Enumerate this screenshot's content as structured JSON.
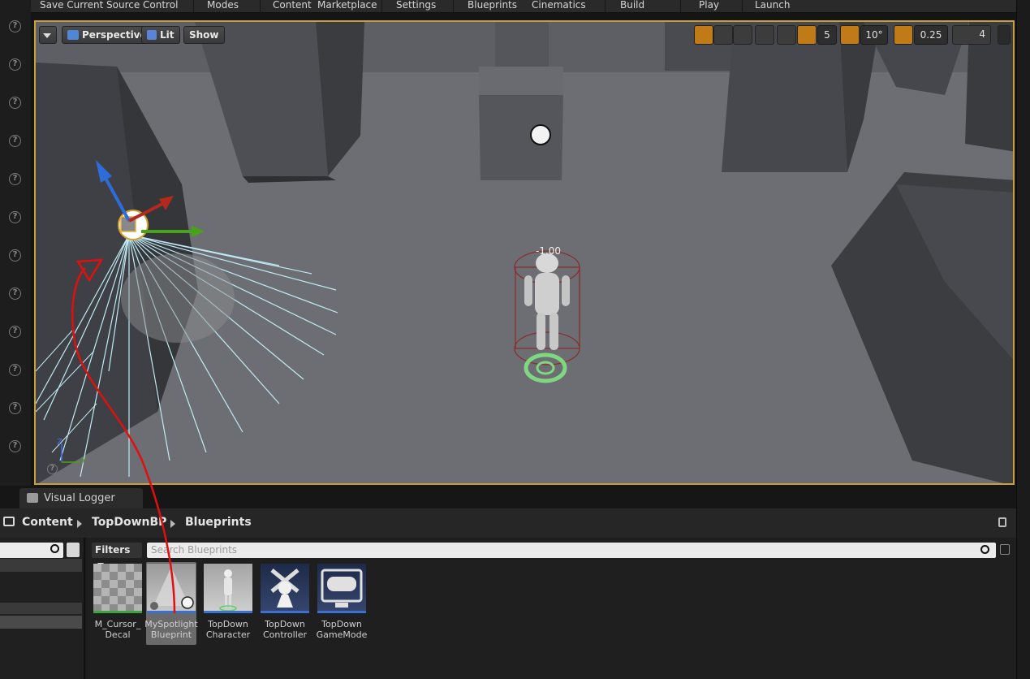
{
  "toolbar": {
    "items": [
      "Save Current",
      "Source Control",
      "Modes",
      "Content",
      "Marketplace",
      "Settings",
      "Blueprints",
      "Cinematics",
      "Build",
      "Play",
      "Launch"
    ]
  },
  "viewport": {
    "menu_icon": "chevron-down-icon",
    "perspective_label": "Perspective",
    "lit_label": "Lit",
    "show_label": "Show",
    "grid_snap_value": "5",
    "rotation_snap_value": "10°",
    "scale_snap_value": "0.25",
    "camera_speed_value": "4",
    "character_label": "-1.00",
    "axis_z": "Z",
    "axis_y": "Y",
    "accent_color": "#c8a03a"
  },
  "bottom": {
    "tab_label": "Visual Logger",
    "breadcrumbs": [
      "Content",
      "TopDownBP",
      "Blueprints"
    ],
    "filters_label": "Filters",
    "search_placeholder": "Search Blueprints",
    "assets": [
      {
        "line1": "M_Cursor_",
        "line2": "Decal",
        "bar_color": "#3fa33f",
        "selected": false
      },
      {
        "line1": "MySpotlight",
        "line2": "Blueprint",
        "bar_color": "#3b6fd1",
        "selected": true
      },
      {
        "line1": "TopDown",
        "line2": "Character",
        "bar_color": "#3b6fd1",
        "selected": false
      },
      {
        "line1": "TopDown",
        "line2": "Controller",
        "bar_color": "#3b6fd1",
        "selected": false
      },
      {
        "line1": "TopDown",
        "line2": "GameMode",
        "bar_color": "#3b6fd1",
        "selected": false
      }
    ]
  },
  "annotation": {
    "color": "#e01010"
  }
}
